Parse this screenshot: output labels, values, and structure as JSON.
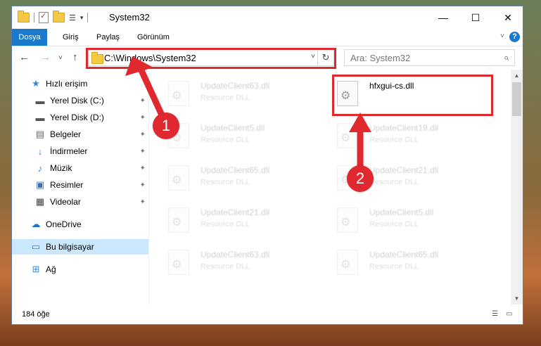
{
  "window": {
    "title": "System32",
    "controls": {
      "minimize": "—",
      "maximize": "☐",
      "close": "✕"
    }
  },
  "ribbon": {
    "tabs": [
      "Dosya",
      "Giriş",
      "Paylaş",
      "Görünüm"
    ],
    "help": "?"
  },
  "navbar": {
    "back": "←",
    "forward": "→",
    "recent": "˅",
    "up": "↑",
    "address": "C:\\Windows\\System32",
    "refresh": "↻",
    "search_placeholder": "Ara: System32",
    "search_icon": "⌕"
  },
  "sidebar": {
    "items": [
      {
        "label": "Hızlı erişim",
        "icon": "★",
        "pinned": false
      },
      {
        "label": "Yerel Disk (C:)",
        "icon": "▬",
        "pinned": true
      },
      {
        "label": "Yerel Disk (D:)",
        "icon": "▬",
        "pinned": true
      },
      {
        "label": "Belgeler",
        "icon": "▤",
        "pinned": true
      },
      {
        "label": "İndirmeler",
        "icon": "↓",
        "pinned": true
      },
      {
        "label": "Müzik",
        "icon": "♪",
        "pinned": true
      },
      {
        "label": "Resimler",
        "icon": "▣",
        "pinned": true
      },
      {
        "label": "Videolar",
        "icon": "▦",
        "pinned": true
      },
      {
        "label": "OneDrive",
        "icon": "☁",
        "pinned": false
      },
      {
        "label": "Bu bilgisayar",
        "icon": "▭",
        "pinned": false
      },
      {
        "label": "Ağ",
        "icon": "⊞",
        "pinned": false
      }
    ],
    "pin_glyph": "📌"
  },
  "files": [
    {
      "name": "UpdateClient63.dll",
      "type": "Resource DLL"
    },
    {
      "name": "hfxgui-cs.dll",
      "type": ""
    },
    {
      "name": "UpdateClient5.dll",
      "type": "Resource DLL"
    },
    {
      "name": "UpdateClient19.dll",
      "type": "Resource DLL"
    },
    {
      "name": "UpdateClient65.dll",
      "type": "Resource DLL"
    },
    {
      "name": "UpdateClient21.dll",
      "type": "Resource DLL"
    },
    {
      "name": "UpdateClient21.dll",
      "type": "Resource DLL"
    },
    {
      "name": "UpdateClient5.dll",
      "type": "Resource DLL"
    },
    {
      "name": "UpdateClient63.dll",
      "type": "Resource DLL"
    },
    {
      "name": "UpdateClient65.dll",
      "type": "Resource DLL"
    }
  ],
  "status": {
    "item_count": "184 öğe"
  },
  "annotations": {
    "step1": "1",
    "step2": "2",
    "color": "#e0282f"
  }
}
